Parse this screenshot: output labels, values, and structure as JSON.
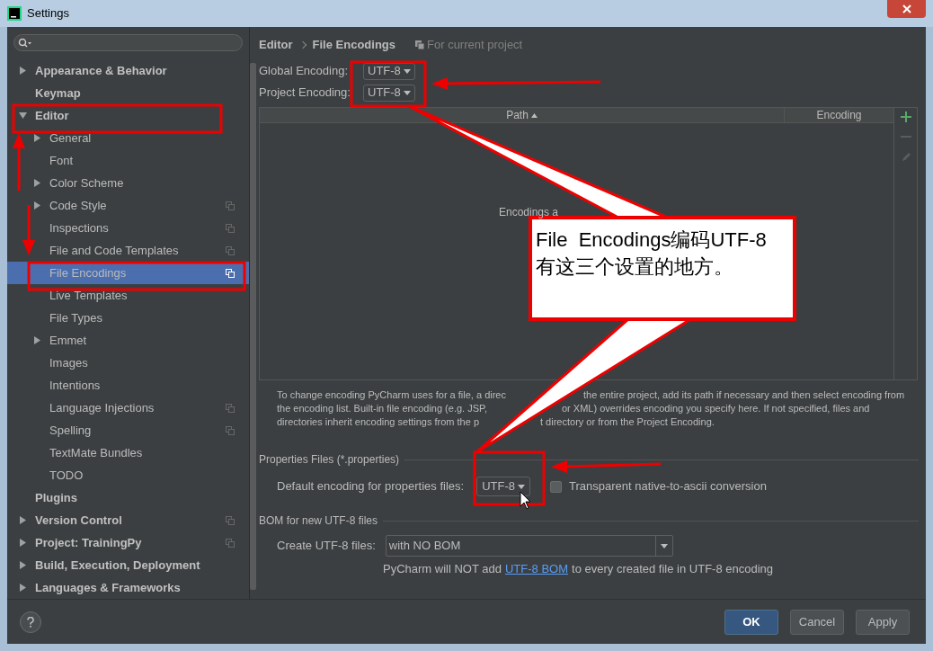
{
  "window": {
    "title": "Settings"
  },
  "sidebar": {
    "items": [
      {
        "label": "Appearance & Behavior",
        "expanded": false,
        "selected": false
      },
      {
        "label": "Keymap",
        "selected": false
      },
      {
        "label": "Editor",
        "expanded": true,
        "selected": false,
        "children": [
          {
            "label": "General",
            "expanded": false,
            "selected": false
          },
          {
            "label": "Font",
            "selected": false
          },
          {
            "label": "Color Scheme",
            "expanded": false,
            "selected": false
          },
          {
            "label": "Code Style",
            "expanded": false,
            "per_project": true,
            "selected": false
          },
          {
            "label": "Inspections",
            "per_project": true,
            "selected": false
          },
          {
            "label": "File and Code Templates",
            "per_project": true,
            "selected": false
          },
          {
            "label": "File Encodings",
            "per_project": true,
            "selected": true
          },
          {
            "label": "Live Templates",
            "selected": false
          },
          {
            "label": "File Types",
            "selected": false
          },
          {
            "label": "Emmet",
            "expanded": false,
            "selected": false
          },
          {
            "label": "Images",
            "selected": false
          },
          {
            "label": "Intentions",
            "selected": false
          },
          {
            "label": "Language Injections",
            "per_project": true,
            "selected": false
          },
          {
            "label": "Spelling",
            "per_project": true,
            "selected": false
          },
          {
            "label": "TextMate Bundles",
            "selected": false
          },
          {
            "label": "TODO",
            "selected": false
          }
        ]
      },
      {
        "label": "Plugins",
        "selected": false
      },
      {
        "label": "Version Control",
        "expanded": false,
        "per_project": true,
        "selected": false
      },
      {
        "label": "Project: TrainingPy",
        "expanded": false,
        "per_project": true,
        "selected": false
      },
      {
        "label": "Build, Execution, Deployment",
        "expanded": false,
        "selected": false
      },
      {
        "label": "Languages & Frameworks",
        "expanded": false,
        "selected": false
      }
    ]
  },
  "breadcrumb": {
    "items": [
      "Editor",
      "File Encodings"
    ],
    "scope_note": "For current project"
  },
  "encodings": [
    {
      "label": "Global Encoding:",
      "value": "UTF-8"
    },
    {
      "label": "Project Encoding:",
      "value": "UTF-8"
    }
  ],
  "table": {
    "columns": [
      {
        "label": "Path",
        "sorted": true
      },
      {
        "label": "Encoding",
        "sorted": false
      }
    ],
    "empty_text": "Encodings a"
  },
  "table_tools": [
    {
      "kind": "add",
      "disabled": false
    },
    {
      "kind": "remove",
      "disabled": true
    },
    {
      "kind": "edit",
      "disabled": true
    }
  ],
  "description_lines": [
    {
      "left": "To change encoding PyCharm uses for a file, a direc",
      "right": "the entire project, add its path if necessary and then select encoding from"
    },
    {
      "left": "the encoding list. Built-in file encoding (e.g. JSP,",
      "right": "or XML) overrides encoding you specify here. If not specified, files and"
    },
    {
      "left": "directories inherit encoding settings from the p",
      "right": "t directory or from the Project Encoding."
    }
  ],
  "properties_section": {
    "title": "Properties Files (*.properties)",
    "label": "Default encoding for properties files:",
    "value": "UTF-8",
    "checkbox": {
      "label": "Transparent native-to-ascii conversion",
      "checked": false
    }
  },
  "bom_section": {
    "title": "BOM for new UTF-8 files",
    "label": "Create UTF-8 files:",
    "value": "with NO BOM",
    "hint_before": "PyCharm will NOT add",
    "hint_link": "UTF-8 BOM",
    "hint_after": "to every created file in UTF-8 encoding"
  },
  "buttons": [
    {
      "label": "OK",
      "default": true
    },
    {
      "label": "Cancel",
      "default": false
    },
    {
      "label": "Apply",
      "default": false
    }
  ],
  "callout": {
    "lines": [
      "File  Encodings编码UTF-8",
      "有这三个设置的地方。"
    ]
  }
}
